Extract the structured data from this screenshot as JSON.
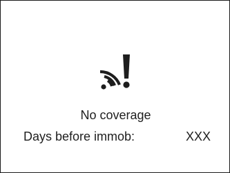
{
  "screen": {
    "icon": "wifi-signal-warning-icon",
    "status_text": "No coverage",
    "days_label": "Days before immob:",
    "days_value": "XXX"
  },
  "colors": {
    "foreground": "#1e1e1e",
    "background": "#ffffff",
    "border": "#1a1a1a"
  }
}
